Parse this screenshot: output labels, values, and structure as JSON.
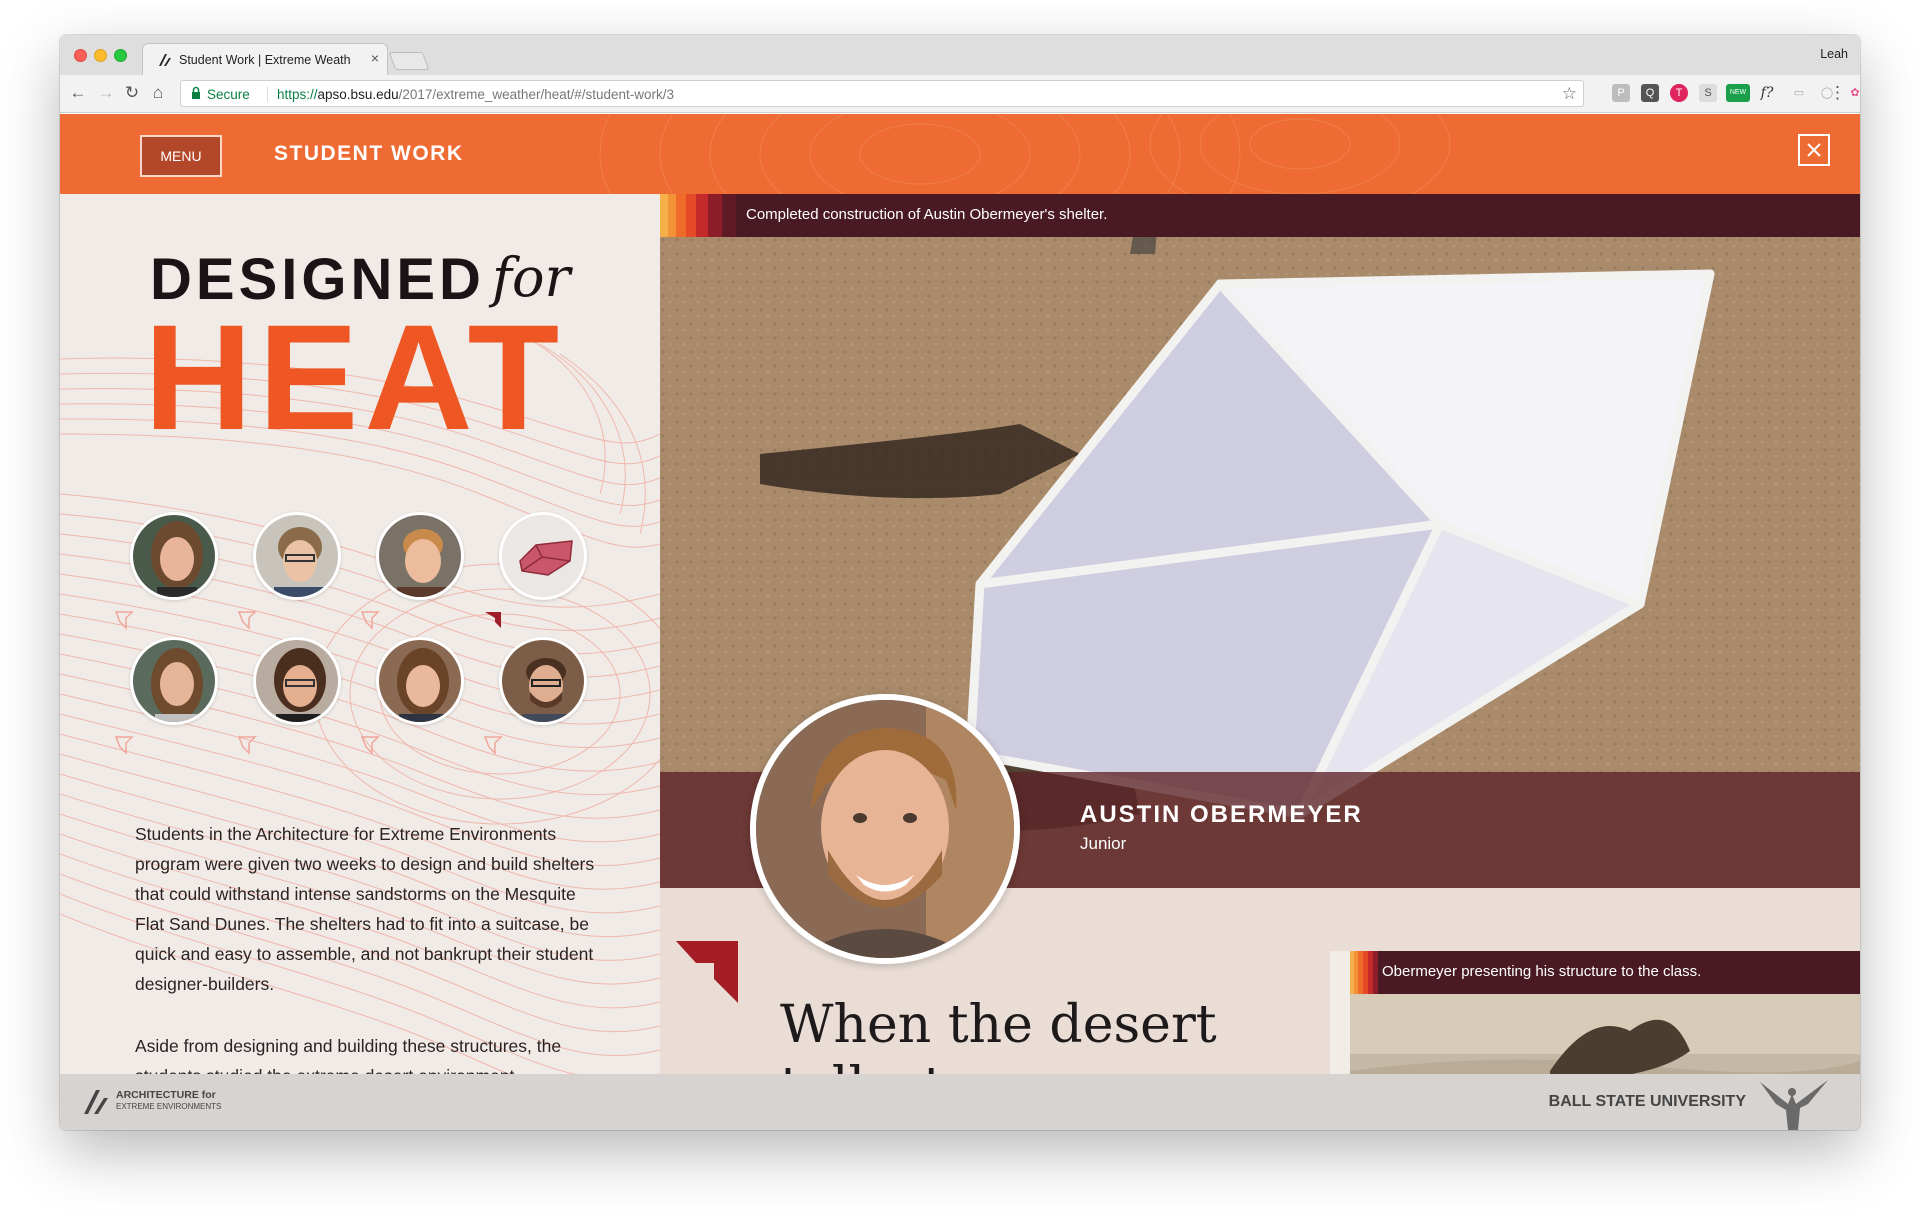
{
  "browser": {
    "tab_title": "Student Work | Extreme Weath",
    "tab_close": "×",
    "profile": "Leah",
    "secure_label": "Secure",
    "url_scheme": "https://",
    "url_host": "apso.bsu.edu",
    "url_path": "/2017/extreme_weather/heat/#/student-work/3",
    "extensions": [
      "P",
      "Q",
      "T",
      "S",
      "NEW",
      "f?",
      "▭",
      "◯",
      "✿"
    ]
  },
  "header": {
    "menu_label": "MENU",
    "title": "STUDENT WORK",
    "brand_color": "#ee6b33"
  },
  "hero": {
    "designed": "DESIGNED",
    "for": "for",
    "heat": "HEAT"
  },
  "students": [
    {
      "name": "student-1"
    },
    {
      "name": "student-2"
    },
    {
      "name": "student-3"
    },
    {
      "name": "shelter-model"
    },
    {
      "name": "student-5"
    },
    {
      "name": "student-6"
    },
    {
      "name": "student-7"
    },
    {
      "name": "student-8"
    }
  ],
  "intro": {
    "p1": "Students in the Architecture for Extreme Environments program were given two weeks to design and build shelters that could withstand intense sandstorms on the Mesquite Flat Sand Dunes. The shelters had to fit into a suitcase, be quick and easy to assemble, and not bankrupt their student designer-builders.",
    "p2": "Aside from designing and building these structures, the students studied the extreme desert environment"
  },
  "feature": {
    "photo_caption": "Completed construction of Austin Obermeyer's shelter.",
    "name": "AUSTIN OBERMEYER",
    "year": "Junior",
    "heading": "When the desert talks to you",
    "thumb_caption": "Obermeyer presenting his structure to the class."
  },
  "footer": {
    "logo_line1": "ARCHITECTURE for",
    "logo_line2": "EXTREME ENVIRONMENTS",
    "university": "BALL STATE UNIVERSITY"
  }
}
